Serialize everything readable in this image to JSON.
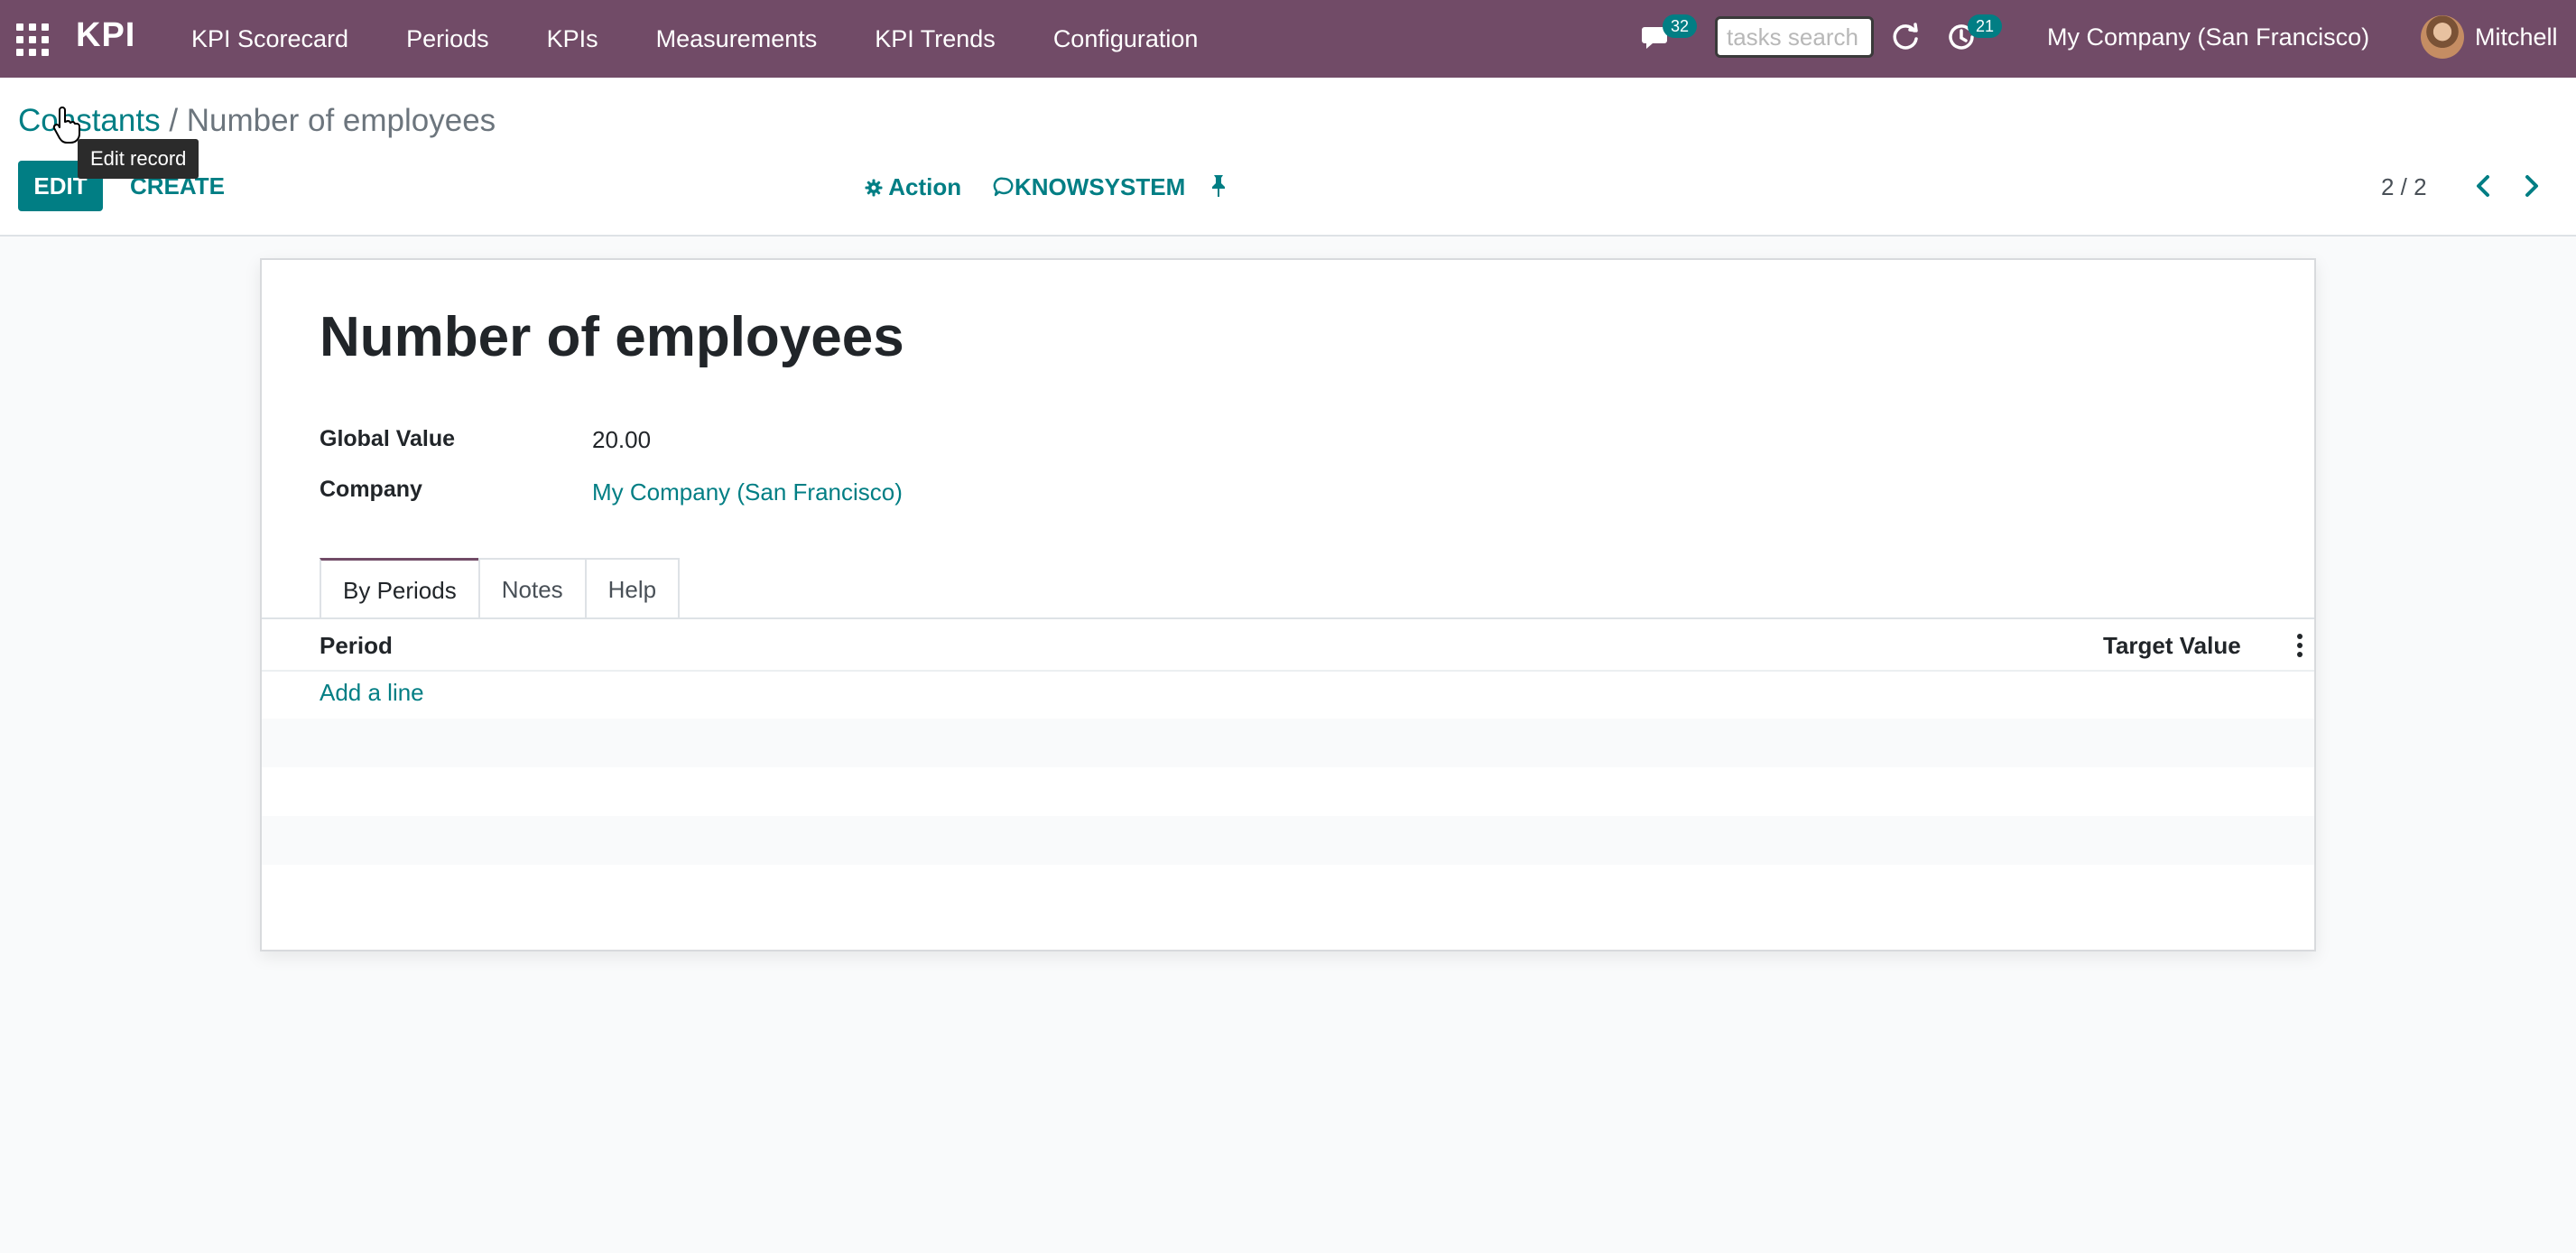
{
  "navbar": {
    "brand": "KPI",
    "menu": [
      "KPI Scorecard",
      "Periods",
      "KPIs",
      "Measurements",
      "KPI Trends",
      "Configuration"
    ],
    "messages_count": "32",
    "search_placeholder": "tasks search",
    "activities_count": "21",
    "company": "My Company (San Francisco)",
    "user": "Mitchell"
  },
  "control_panel": {
    "breadcrumb_parent": "Constants",
    "breadcrumb_separator": " / ",
    "breadcrumb_current": "Number of employees",
    "edit_label": "EDIT",
    "create_label": "CREATE",
    "tooltip": "Edit record",
    "action_label": "Action",
    "knowsystem_label": "KNOWSYSTEM",
    "pager": "2 / 2"
  },
  "form": {
    "title": "Number of employees",
    "fields": [
      {
        "label": "Global Value",
        "value": "20.00"
      },
      {
        "label": "Company",
        "value": "My Company (San Francisco)"
      }
    ],
    "tabs": [
      "By Periods",
      "Notes",
      "Help"
    ],
    "active_tab": "By Periods",
    "columns": [
      "Period",
      "Target Value"
    ],
    "add_line_label": "Add a line"
  },
  "colors": {
    "navbar": "#714b67",
    "accent": "#017e84"
  }
}
